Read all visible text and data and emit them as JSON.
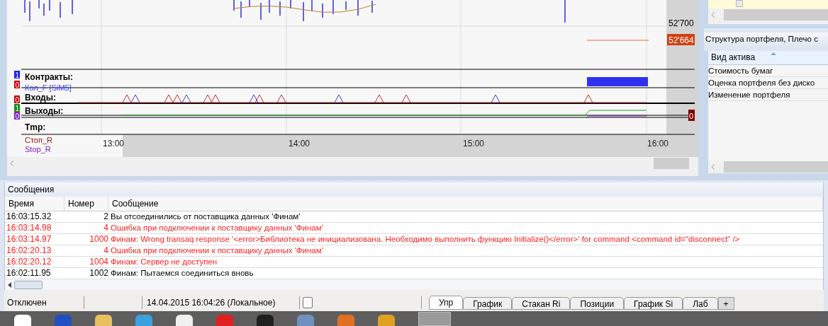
{
  "chart": {
    "price_labels": [
      "52'700"
    ],
    "last_price": "52'664",
    "zero_badge": "0",
    "channel_digits": [
      {
        "text": "1",
        "color": "#2020e0"
      },
      {
        "text": "0",
        "color": "#c00000"
      },
      {
        "text": "0",
        "color": "#c00000"
      },
      {
        "text": "1",
        "color": "#109010"
      },
      {
        "text": "0",
        "color": "#8020c0"
      }
    ],
    "legend": [
      {
        "text": "Контракты:",
        "kind": "heading"
      },
      {
        "text": "Кол_F [SiM5]",
        "kind": "series",
        "color": "#4040ff"
      },
      {
        "text": "Входы:",
        "kind": "heading"
      },
      {
        "text": "Выходы:",
        "kind": "heading"
      },
      {
        "text": "Tmp:",
        "kind": "heading"
      },
      {
        "text": "Стоп_R",
        "kind": "series",
        "color": "#a01010"
      },
      {
        "text": "Stop_R",
        "kind": "series",
        "color": "#8020c0"
      }
    ],
    "time_ticks": [
      "13:00",
      "14:00",
      "15:00",
      "16:00"
    ]
  },
  "portfolio": {
    "title": "Структура портфеля, Плечо с",
    "column": "Вид актива",
    "rows": [
      "Стоимость бумаг",
      "Оценка портфеля без диско",
      "Изменение портфеля"
    ]
  },
  "messages": {
    "title": "Сообщения",
    "columns": [
      "Время",
      "Номер",
      "Сообщение"
    ],
    "rows": [
      {
        "time": "16:03:15.32",
        "number": "2",
        "text": "Вы отсоединились от поставщика данных 'Финам'",
        "kind": "info"
      },
      {
        "time": "16:03:14.98",
        "number": "4",
        "text": "Ошибка при подключении к поставщику данных 'Финам'",
        "kind": "error"
      },
      {
        "time": "16:03:14.97",
        "number": "1000",
        "text": "Финам: Wrong transaq response '<error>Библиотека не инициализована. Необходимо выполнить функцию Initialize()</error>' for command <command id=\"disconnect\" />",
        "kind": "error"
      },
      {
        "time": "16:02:20.13",
        "number": "4",
        "text": "Ошибка при подключении к поставщику данных 'Финам'",
        "kind": "error"
      },
      {
        "time": "16:02:20.12",
        "number": "1004",
        "text": "Финам: Сервер не доступен",
        "kind": "error"
      },
      {
        "time": "16:02:11.95",
        "number": "1002",
        "text": "Финам: Пытаемся соединиться вновь",
        "kind": "info"
      }
    ]
  },
  "status_bar": {
    "connection": "Отключен",
    "datetime": "14.04.2015 16:04:26 (Локальное)"
  },
  "tabs": [
    {
      "label": "Упр",
      "selected": true
    },
    {
      "label": "График",
      "selected": false
    },
    {
      "label": "Стакан Ri",
      "selected": false
    },
    {
      "label": "Позиции",
      "selected": false
    },
    {
      "label": "График Si",
      "selected": false
    },
    {
      "label": "Лаб",
      "selected": false
    }
  ],
  "add_tab": "+"
}
